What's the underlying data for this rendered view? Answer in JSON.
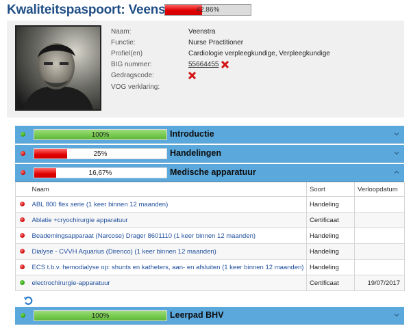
{
  "header": {
    "title": "Kwaliteitspaspoort: Veenstra",
    "progress_label": "42.86%",
    "progress_value": 0.4286
  },
  "profile": {
    "fields": [
      {
        "label": "Naam:",
        "value": "Veenstra"
      },
      {
        "label": "Functie:",
        "value": "Nurse Practitioner"
      },
      {
        "label": "Profiel(en)",
        "value": "Cardiologie verpleegkundige, Verpleegkundige"
      },
      {
        "label": "BIG nummer:",
        "value": "55664455",
        "status": "invalid"
      },
      {
        "label": "Gedragscode:",
        "value": "",
        "status": "invalid"
      },
      {
        "label": "VOG verklaring:",
        "value": ""
      }
    ]
  },
  "sections": [
    {
      "title": "Introductie",
      "progress_label": "100%",
      "progress_value": 1.0,
      "status": "green",
      "expanded": false
    },
    {
      "title": "Handelingen",
      "progress_label": "25%",
      "progress_value": 0.25,
      "status": "red",
      "expanded": false
    },
    {
      "title": "Medische apparatuur",
      "progress_label": "16,67%",
      "progress_value": 0.1667,
      "status": "red",
      "expanded": true
    },
    {
      "title": "Leerpad BHV",
      "progress_label": "100%",
      "progress_value": 1.0,
      "status": "green",
      "expanded": false
    }
  ],
  "table": {
    "columns": [
      "Naam",
      "Soort",
      "Verloopdatum"
    ],
    "rows": [
      {
        "status": "red",
        "name": "ABL 800 flex serie (1 keer binnen 12 maanden)",
        "type": "Handeling",
        "date": ""
      },
      {
        "status": "red",
        "name": "Ablatie +cryochirurgie apparatuur",
        "type": "Certificaat",
        "date": ""
      },
      {
        "status": "red",
        "name": "Beademingsapparaat (Narcose) Drager 8601110 (1 keer binnen 12 maanden)",
        "type": "Handeling",
        "date": ""
      },
      {
        "status": "red",
        "name": "Dialyse - CVVH Aquarius (Direnco) (1 keer binnen 12 maanden)",
        "type": "Handeling",
        "date": ""
      },
      {
        "status": "red",
        "name": "ECS t.b.v. hemodialyse op: shunts en katheters, aan- en afsluiten (1 keer binnen 12 maanden)",
        "type": "Handeling",
        "date": ""
      },
      {
        "status": "green",
        "name": "electrochirurgie-apparatuur",
        "type": "Certificaat",
        "date": "19/07/2017"
      }
    ]
  },
  "icons": {
    "invalid": "x-mark-icon",
    "refresh": "refresh-icon",
    "collapsed": "chevron-down-icon",
    "expanded": "chevron-up-icon"
  },
  "colors": {
    "title": "#1f4e86",
    "section_bar": "#5aa8dc",
    "progress_red": "#e00000",
    "progress_green": "#74c84c",
    "link": "#1f4e9c"
  }
}
